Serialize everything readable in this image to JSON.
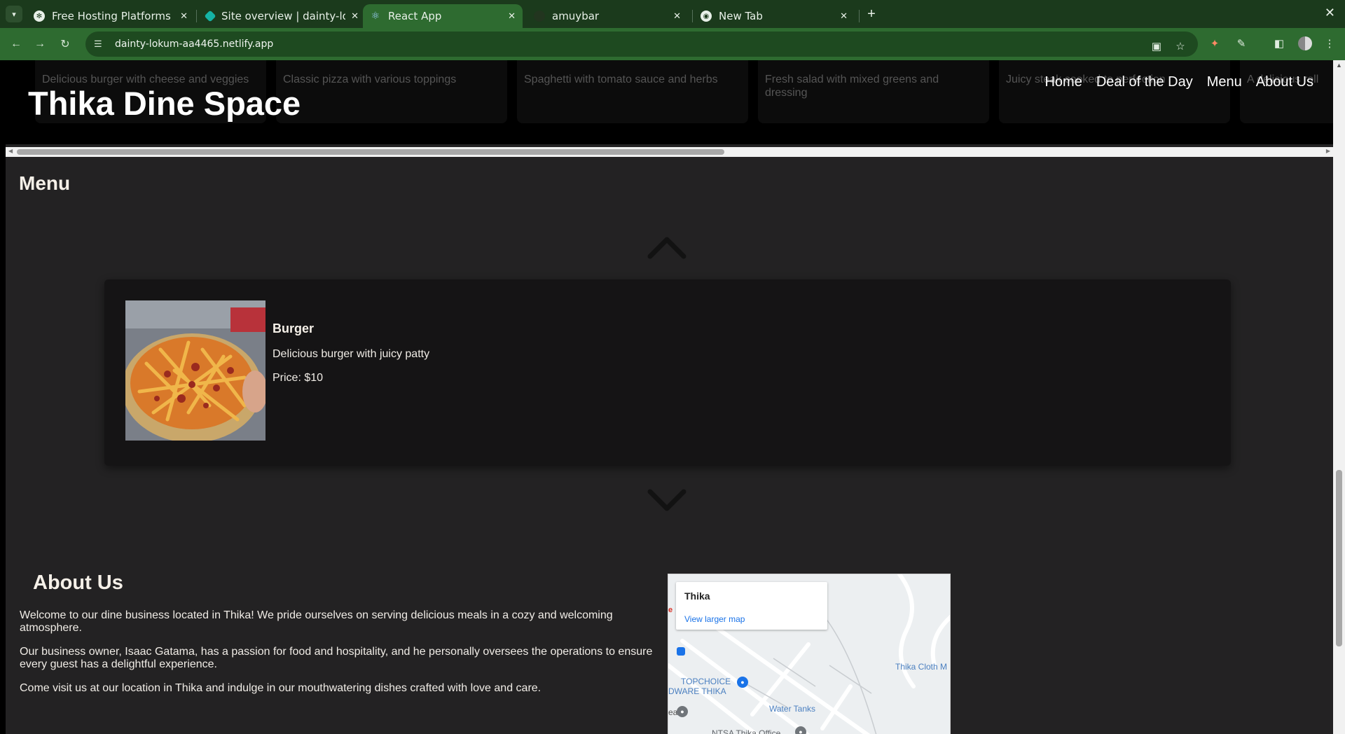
{
  "browser": {
    "tabs": [
      {
        "title": "Free Hosting Platforms",
        "icon": "chatgpt-icon"
      },
      {
        "title": "Site overview | dainty-lok",
        "icon": "netlify-icon"
      },
      {
        "title": "React App",
        "icon": "react-icon",
        "active": true
      },
      {
        "title": "amuybar",
        "icon": "github-icon"
      },
      {
        "title": "New Tab",
        "icon": "chrome-icon"
      }
    ],
    "url": "dainty-lokum-aa4465.netlify.app",
    "theme_color": "#2e6b30"
  },
  "site": {
    "title": "Thika Dine Space",
    "nav": [
      "Home",
      "Deal of the Day",
      "Menu",
      "About Us"
    ],
    "carousel_cards": [
      "Delicious burger with cheese and veggies",
      "Classic pizza with various toppings",
      "Spaghetti with tomato sauce and herbs",
      "Fresh salad with mixed greens and dressing",
      "Juicy steak cooked to perfection",
      "A delicious roll"
    ]
  },
  "menu": {
    "heading": "Menu",
    "item": {
      "name": "Burger",
      "description": "Delicious burger with juicy patty",
      "price": "Price: $10"
    }
  },
  "about": {
    "heading": "About Us",
    "paragraphs": [
      "Welcome to our dine business located in Thika! We pride ourselves on serving delicious meals in a cozy and welcoming atmosphere.",
      "Our business owner, Isaac Gatama, has a passion for food and hospitality, and he personally oversees the operations to ensure every guest has a delightful experience.",
      "Come visit us at our location in Thika and indulge in our mouthwatering dishes crafted with love and care."
    ]
  },
  "map": {
    "place": "Thika",
    "larger_link": "View larger map",
    "labels": {
      "cloth": "Thika Cloth M",
      "hardware_1": "TOPCHOICE",
      "hardware_2": "DWARE THIKA",
      "water": "Water Tanks",
      "ntsa": "NTSA Thika Office",
      "edge_e": "e",
      "edge_ea": "ea"
    }
  }
}
